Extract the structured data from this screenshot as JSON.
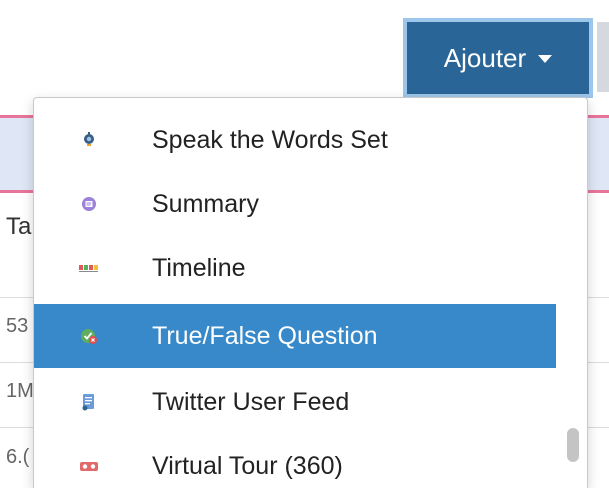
{
  "header": {
    "add_button_label": "Ajouter"
  },
  "background": {
    "column_header": "Ta",
    "cells": [
      "53",
      "1M",
      "6.("
    ]
  },
  "dropdown": {
    "items": [
      {
        "label": "Speak the Words Set",
        "icon": "microphone-icon"
      },
      {
        "label": "Summary",
        "icon": "summary-icon"
      },
      {
        "label": "Timeline",
        "icon": "timeline-icon"
      },
      {
        "label": "True/False Question",
        "icon": "true-false-icon",
        "active": true
      },
      {
        "label": "Twitter User Feed",
        "icon": "twitter-feed-icon"
      },
      {
        "label": "Virtual Tour (360)",
        "icon": "virtual-tour-icon"
      }
    ]
  },
  "colors": {
    "button_bg": "#2a6597",
    "button_border": "#9cc6ea",
    "active_item_bg": "#3789c9",
    "pink_border": "#e7759b"
  }
}
